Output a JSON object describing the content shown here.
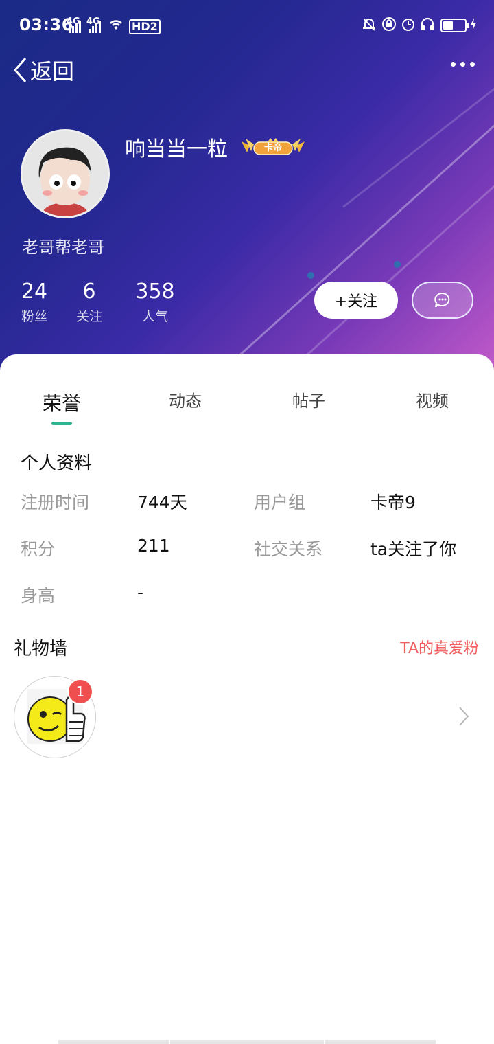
{
  "status_bar": {
    "time": "03:36",
    "net1": "4G",
    "net2": "4G",
    "hd": "HD2",
    "battery_level": 0.45
  },
  "nav": {
    "back_label": "返回"
  },
  "profile": {
    "username": "响当当一粒",
    "vip_badge": "卡帝",
    "signature": "老哥帮老哥",
    "stats": [
      {
        "value": "24",
        "label": "粉丝"
      },
      {
        "value": "6",
        "label": "关注"
      },
      {
        "value": "358",
        "label": "人气"
      }
    ],
    "follow_label": "+关注"
  },
  "tabs": [
    {
      "label": "荣誉",
      "active": true
    },
    {
      "label": "动态",
      "active": false
    },
    {
      "label": "帖子",
      "active": false
    },
    {
      "label": "视频",
      "active": false
    }
  ],
  "personal_info": {
    "title": "个人资料",
    "register_label": "注册时间",
    "register_value": "744天",
    "group_label": "用户组",
    "group_value": "卡帝9",
    "points_label": "积分",
    "points_value": "211",
    "relation_label": "社交关系",
    "relation_value": "ta关注了你",
    "height_label": "身高",
    "height_value": "-"
  },
  "gift_wall": {
    "title": "礼物墙",
    "link": "TA的真爱粉",
    "gift_count": "1"
  },
  "colors": {
    "accent": "#2fb38f",
    "link_red": "#ef5f5f",
    "badge_red": "#ef4f4f"
  }
}
